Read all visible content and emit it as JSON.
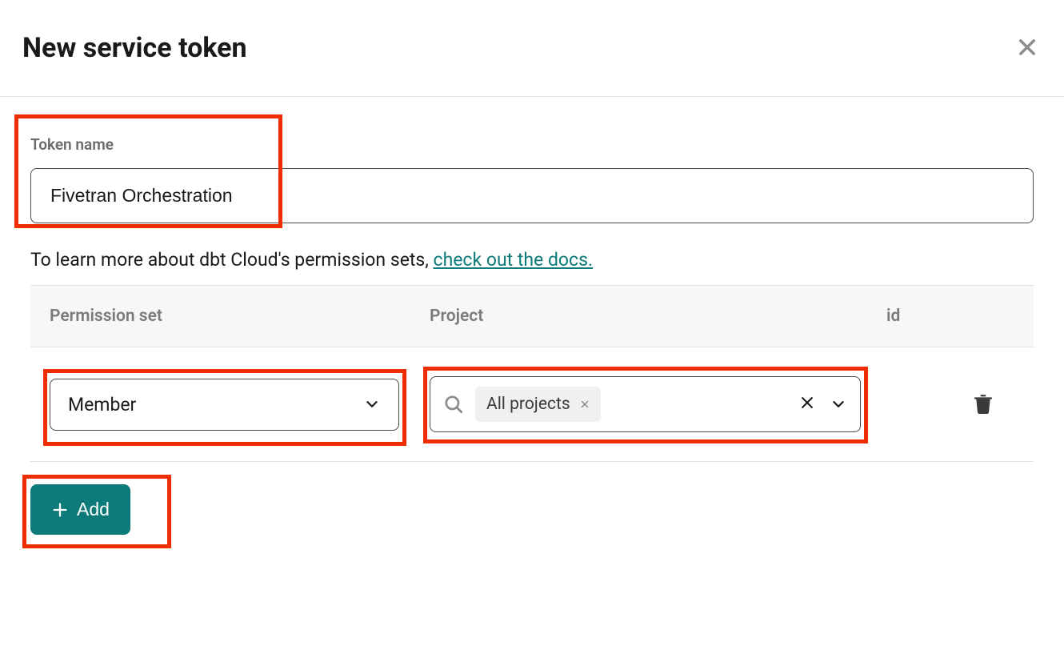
{
  "header": {
    "title": "New service token"
  },
  "token_name": {
    "label": "Token name",
    "value": "Fivetran Orchestration"
  },
  "help": {
    "text": "To learn more about dbt Cloud's permission sets, ",
    "link_text": "check out the docs."
  },
  "table": {
    "columns": {
      "permission": "Permission set",
      "project": "Project",
      "id": "id"
    },
    "rows": [
      {
        "permission": "Member",
        "project_chip": "All projects"
      }
    ]
  },
  "add_button": "Add"
}
